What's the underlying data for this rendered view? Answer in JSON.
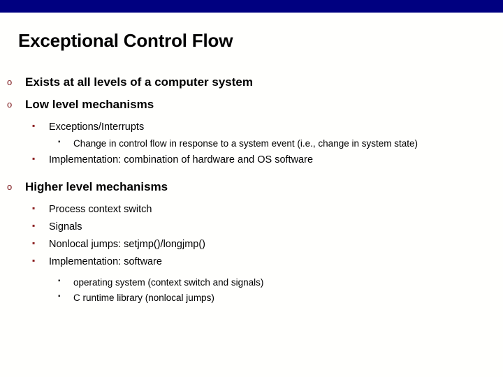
{
  "slide": {
    "title": "Exceptional Control Flow",
    "accent_bar_color": "#000080",
    "background_color": "#fffffd",
    "level1_bullet_color": "#7b1618",
    "level2_bullet_color": "#8c2020",
    "level3_bullet_color": "#2b2b2b",
    "bullet_glyphs": {
      "level1": "o",
      "level2": "▪",
      "level3": "▪"
    }
  },
  "content": {
    "item1": {
      "level": 1,
      "text": "Exists at all levels of a computer system"
    },
    "item2": {
      "level": 1,
      "text": "Low level mechanisms"
    },
    "item2_sub1": {
      "level": 2,
      "text": "Exceptions/Interrupts"
    },
    "item2_sub1_sub1": {
      "level": 3,
      "text": "Change in control flow in response to a system event (i.e.,  change in system state)"
    },
    "item2_sub2": {
      "level": 2,
      "text": "Implementation: combination of hardware and OS software"
    },
    "item3": {
      "level": 1,
      "text": "Higher level mechanisms"
    },
    "item3_sub1": {
      "level": 2,
      "text": "Process context switch"
    },
    "item3_sub2": {
      "level": 2,
      "text": "Signals"
    },
    "item3_sub3": {
      "level": 2,
      "text": "Nonlocal jumps: setjmp()/longjmp()"
    },
    "item3_sub4": {
      "level": 2,
      "text": "Implementation: software"
    },
    "item3_sub4_sub1": {
      "level": 3,
      "text": "operating system (context switch and signals)"
    },
    "item3_sub4_sub2": {
      "level": 3,
      "text": "C runtime library (nonlocal jumps)"
    }
  }
}
